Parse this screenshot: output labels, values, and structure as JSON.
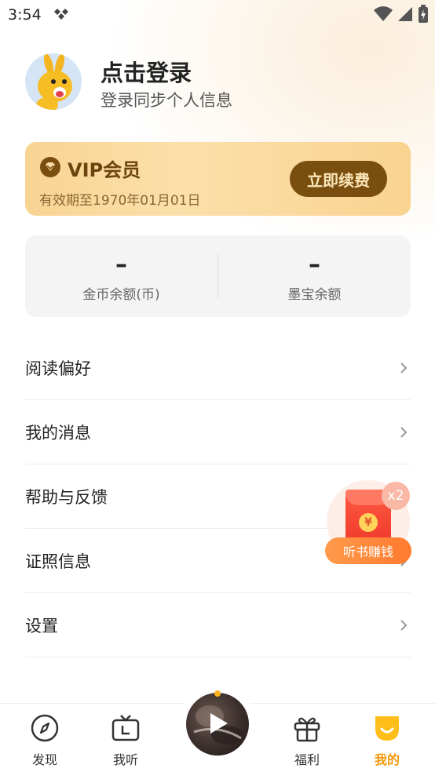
{
  "status_bar": {
    "time": "3:54"
  },
  "profile": {
    "title": "点击登录",
    "subtitle": "登录同步个人信息"
  },
  "vip": {
    "title": "VIP会员",
    "expire": "有效期至1970年01月01日",
    "renew_button": "立即续费"
  },
  "balance": [
    {
      "value": "–",
      "label": "金币余额(币)"
    },
    {
      "value": "–",
      "label": "墨宝余额"
    }
  ],
  "menu": [
    {
      "label": "阅读偏好"
    },
    {
      "label": "我的消息"
    },
    {
      "label": "帮助与反馈"
    },
    {
      "label": "证照信息"
    },
    {
      "label": "设置"
    }
  ],
  "floating_reward": {
    "badge": "x2",
    "label": "听书赚钱",
    "coin_symbol": "¥"
  },
  "bottom_nav": {
    "items": [
      {
        "label": "发现",
        "icon": "compass-icon"
      },
      {
        "label": "我听",
        "icon": "tv-icon"
      },
      {
        "label": "福利",
        "icon": "gift-icon"
      },
      {
        "label": "我的",
        "icon": "smile-icon",
        "active": true
      }
    ]
  },
  "colors": {
    "accent": "#f29a0c",
    "vip_dark": "#7a4e0e",
    "vip_light": "#f8d492",
    "reward": "#ff7a2f"
  }
}
